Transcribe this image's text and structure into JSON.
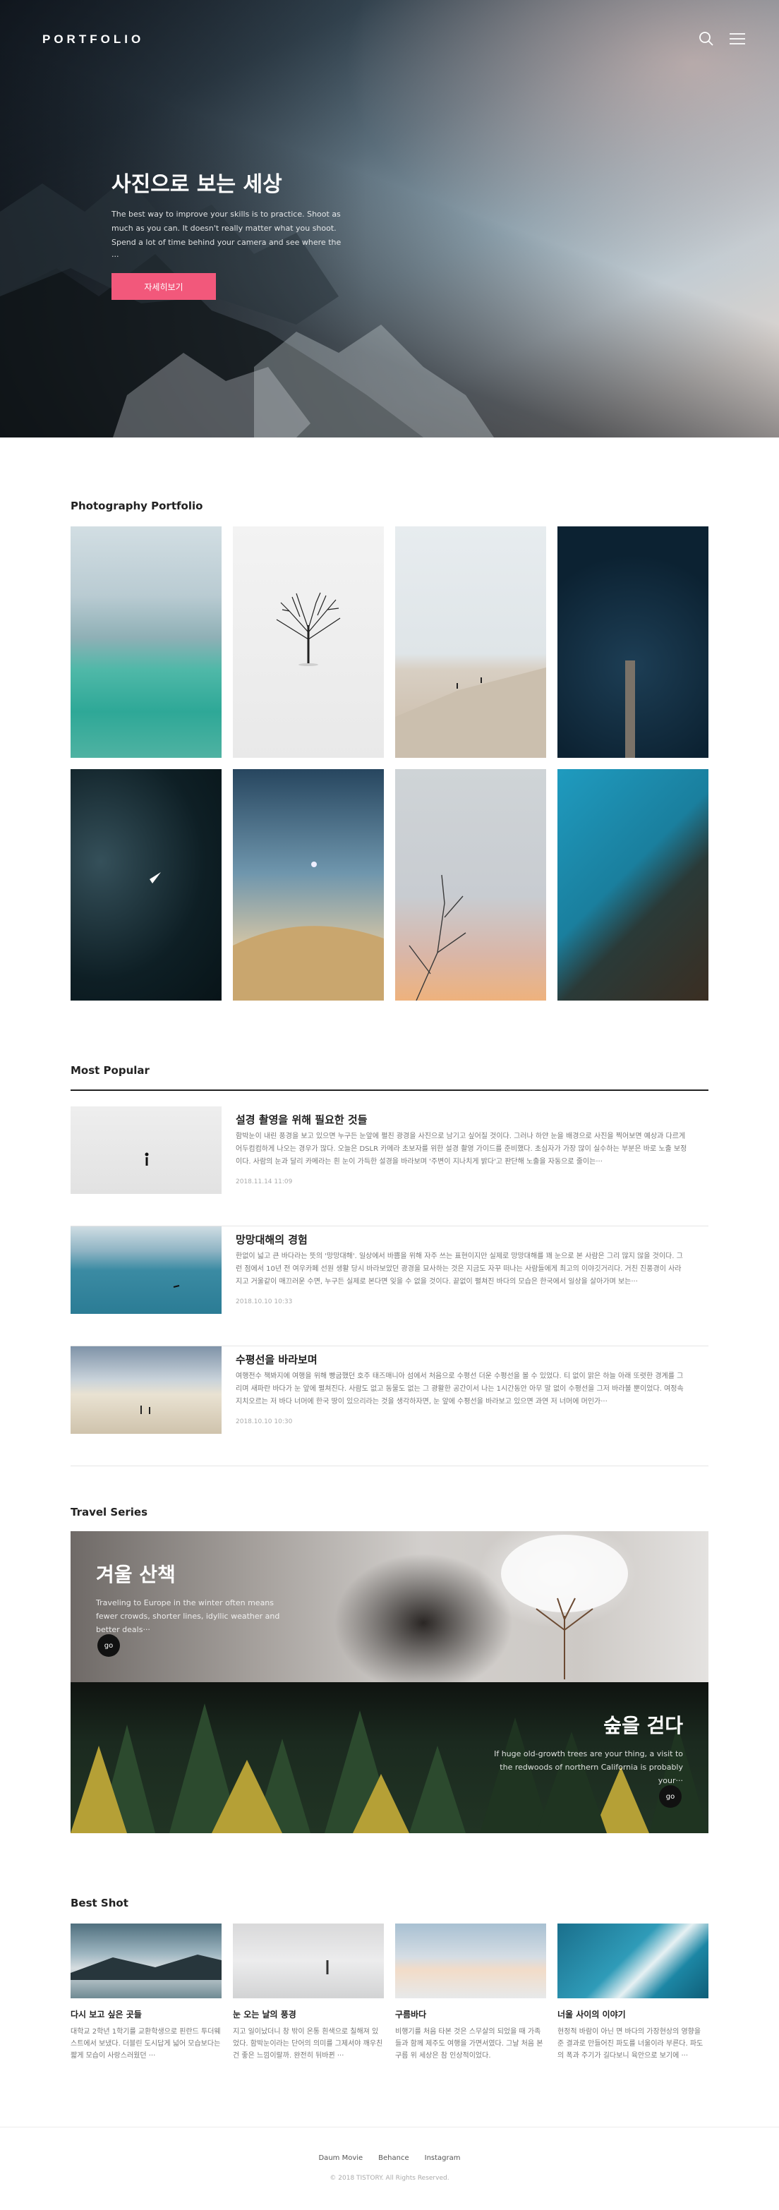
{
  "header": {
    "logo": "PORTFOLIO",
    "search_icon": "search-icon",
    "menu_icon": "menu-icon"
  },
  "hero": {
    "title": "사진으로 보는 세상",
    "description": "The best way to improve your skills is to practice. Shoot as much as you can. It doesn't really matter what you shoot. Spend a lot of time behind your camera and see where the ···",
    "button": "자세히보기",
    "accent": "#f2587b"
  },
  "portfolio": {
    "title": "Photography Portfolio"
  },
  "popular": {
    "title": "Most Popular",
    "items": [
      {
        "title": "설경 촬영을 위해 필요한 것들",
        "text": "함박눈이 내린 풍경을 보고 있으면 누구든 눈앞에 펼친 광경을 사진으로 남기고 싶어질 것이다. 그러나 하얀 눈을 배경으로 사진을 찍어보면 예상과 다르게 어두컴컴하게 나오는 경우가 많다. 오늘은 DSLR 카메라 초보자를 위한 설경 촬영 가이드를 준비했다. 초심자가 가장 많이 실수하는 부분은 바로 노출 보정이다. 사람의 눈과 달리 카메라는 흰 눈이 가득한 설경을 바라보며 '주변이 지나치게 밝다'고 판단해 노출을 자동으로 줄이는···",
        "date": "2018.11.14 11:09"
      },
      {
        "title": "망망대해의 경험",
        "text": "한없이 넓고 큰 바다라는 뜻의 '망망대해'. 일상에서 바쁨을 위해 자주 쓰는 표현이지만 실제로 망망대해를 꽤 눈으로 본 사람은 그리 많지 않을 것이다. 그런 점에서 10년 전 여우카페 선원 생활 당시 바라보았던 광경을 묘사하는 것은 지금도 자꾸 떠나는 사람들에게 최고의 이야깃거리다. 거친 진풍경이 사라지고 거울같이 매끄러운 수면, 누구든 실제로 본다면 잊을 수 없을 것이다. 끝없이 펼쳐진 바다의 모습은 한국에서 일상을 살아가며 보는···",
        "date": "2018.10.10 10:33"
      },
      {
        "title": "수평선을 바라보며",
        "text": "여행전수 책봐지에 여행을 위해 빵굽했던 호주 태즈매니아 섬에서 처음으로 수평선 더운 수평선을 볼 수 있었다. 티 없이 맑은 하늘 아래 또렷한 경계를 그리며 새파란 바다가 눈 앞에 펼쳐진다. 사람도 없고 동물도 없는 그 광활한 공간이서 나는 1시간동안 아무 말 없이 수평선을 그저 바라볼 뿐이었다. 여정속 지치오르는 저 바다 너머에 한국 땅이 있으리라는 것을 생각하자면, 눈 앞에 수평선을 바라보고 있으면 과연 저 너머에 머인가···",
        "date": "2018.10.10 10:30"
      }
    ]
  },
  "travel": {
    "title": "Travel Series",
    "items": [
      {
        "title": "겨울 산책",
        "text": "Traveling to Europe in the winter often means fewer crowds, shorter lines, idyllic weather and better deals···",
        "button": "go"
      },
      {
        "title": "숲을 걷다",
        "text": "If huge old-growth trees are your thing, a visit to the redwoods of northern California is probably your···",
        "button": "go"
      }
    ]
  },
  "best": {
    "title": "Best Shot",
    "items": [
      {
        "title": "다시 보고 싶은 곳들",
        "text": "대학교 2학년 1학기를 교환학생으로 핀란드 투더웨스트에서 보냈다. 더블린 도시답게 넓어 모습보다는 짧게 모습이 사랑스러웠던 ···"
      },
      {
        "title": "눈 오는 날의 풍경",
        "text": "지고 일이났더니 창 밖이 온통 흰색으로 칠해져 있었다. 함박눈이라는 단어의 의미를 그제서야 깨우친 건 좋은 느낌이랄까. 완전히 뒤바뀐 ···"
      },
      {
        "title": "구름바다",
        "text": "비행기를 처음 타본 것은 스무살의 되었을 때 가족들과 함께 제주도 여행을 가면서였다. 그날 처음 본 구름 위 세상은 참 인상적이었다."
      },
      {
        "title": "너울 사이의 이야기",
        "text": "현정적 바람이 아닌 면 바다의 가장현상의 영향을 준 결과로 만들어진 파도를 너울이라 부른다. 파도의 폭과 주기가 길다보니 육안으로 보기에 ···"
      }
    ]
  },
  "footer": {
    "links": [
      "Daum Movie",
      "Behance",
      "Instagram"
    ],
    "copyright": "© 2018 TISTORY. All Rights Reserved."
  }
}
